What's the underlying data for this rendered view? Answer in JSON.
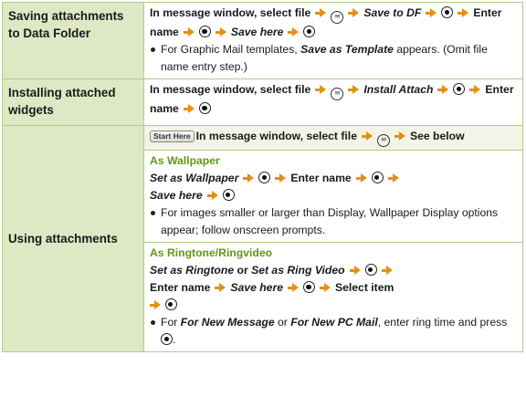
{
  "icons": {
    "arrow": "right-arrow-icon",
    "center_key": "center-key-icon",
    "menu_key": "mail-menu-key-icon",
    "menu_key_glyph": "✉",
    "accent_green": "#5f9a14",
    "arrow_orange": "#e38f16",
    "label_bg": "#dfe8c4"
  },
  "rows": [
    {
      "label": "Saving attachments to Data Folder",
      "steps": {
        "a1": "In message window, select file",
        "a2": "Save to DF",
        "a3": "Enter name",
        "a4": "Save here"
      },
      "bullet": {
        "pre": "For Graphic Mail templates,",
        "emph": "Save as Template",
        "post": "appears. (Omit file name entry step.)"
      }
    },
    {
      "label": "Installing attached widgets",
      "steps": {
        "a1": "In message window, select file",
        "a2": "Install Attach",
        "a3": "Enter name"
      }
    },
    {
      "label": "Using attachments",
      "start_badge": "Start Here",
      "intro": {
        "a1": "In message window, select file",
        "a2": "See below"
      },
      "wallpaper": {
        "heading": "As Wallpaper",
        "s1": "Set as Wallpaper",
        "s2": "Enter name",
        "s3": "Save here",
        "bullet": "For images smaller or larger than Display, Wallpaper Display options appear; follow onscreen prompts."
      },
      "ringtone": {
        "heading": "As Ringtone/Ringvideo",
        "s1": "Set as Ringtone",
        "or": "or",
        "s2": "Set as Ring Video",
        "s3": "Enter name",
        "s4": "Save here",
        "s5": "Select item",
        "bullet": {
          "pre": "For",
          "e1": "For New Message",
          "mid": "or",
          "e2": "For New PC Mail",
          "post": ", enter ring time and press",
          "end": "."
        }
      }
    }
  ]
}
